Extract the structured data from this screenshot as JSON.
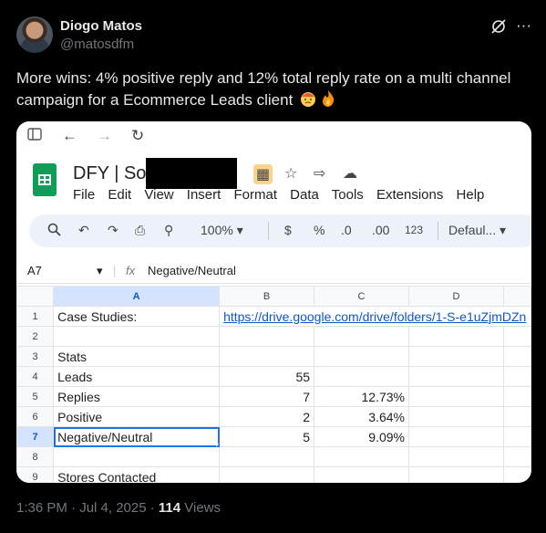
{
  "author": {
    "name": "Diogo Matos",
    "handle": "@matosdfm"
  },
  "tweet": {
    "text": "More wins: 4% positive reply and 12% total reply rate on a multi channel campaign for a Ecommerce Leads client"
  },
  "meta": {
    "time": "1:36 PM · Jul 4, 2025 · ",
    "views": "114",
    "views_label": " Views"
  },
  "sheet": {
    "title": "DFY | Soci",
    "menu": [
      "File",
      "Edit",
      "View",
      "Insert",
      "Format",
      "Data",
      "Tools",
      "Extensions",
      "Help"
    ],
    "toolbar": {
      "zoom": "100%",
      "currency": "$",
      "percent": "%",
      "dec_less": ".0",
      "dec_more": ".00",
      "format_123": "123",
      "font": "Defaul..."
    },
    "cell_ref": "A7",
    "fx": "fx",
    "formula": "Negative/Neutral",
    "columns": [
      "A",
      "B",
      "C",
      "D"
    ],
    "rows": [
      {
        "n": "1",
        "a": "Case Studies:",
        "b": "https://drive.google.com/drive/folders/1-S-e1uZjmDZn",
        "c": "",
        "d": ""
      },
      {
        "n": "2",
        "a": "",
        "b": "",
        "c": "",
        "d": ""
      },
      {
        "n": "3",
        "a": "Stats",
        "b": "",
        "c": "",
        "d": ""
      },
      {
        "n": "4",
        "a": "Leads",
        "b": "55",
        "c": "",
        "d": ""
      },
      {
        "n": "5",
        "a": "Replies",
        "b": "7",
        "c": "12.73%",
        "d": ""
      },
      {
        "n": "6",
        "a": "Positive",
        "b": "2",
        "c": "3.64%",
        "d": ""
      },
      {
        "n": "7",
        "a": "Negative/Neutral",
        "b": "5",
        "c": "9.09%",
        "d": ""
      },
      {
        "n": "8",
        "a": "",
        "b": "",
        "c": "",
        "d": ""
      },
      {
        "n": "9",
        "a": "Stores Contacted",
        "b": "",
        "c": "",
        "d": ""
      }
    ]
  },
  "icons": {
    "mute": "mute-icon",
    "more": "more-icon",
    "sidebar": "sidebar-icon",
    "back": "back-icon",
    "forward": "forward-icon",
    "reload": "reload-icon",
    "search": "search-icon",
    "undo": "undo-icon",
    "redo": "redo-icon",
    "print": "print-icon",
    "paint": "paint-format-icon",
    "star": "star-icon",
    "move": "move-folder-icon",
    "cloud": "cloud-status-icon",
    "emoji_face": "emoji-face-icon",
    "emoji_fire": "emoji-fire-icon"
  },
  "colors": {
    "link": "#1155cc",
    "selection": "#1a73e8",
    "sheets_green": "#0f9d58"
  }
}
